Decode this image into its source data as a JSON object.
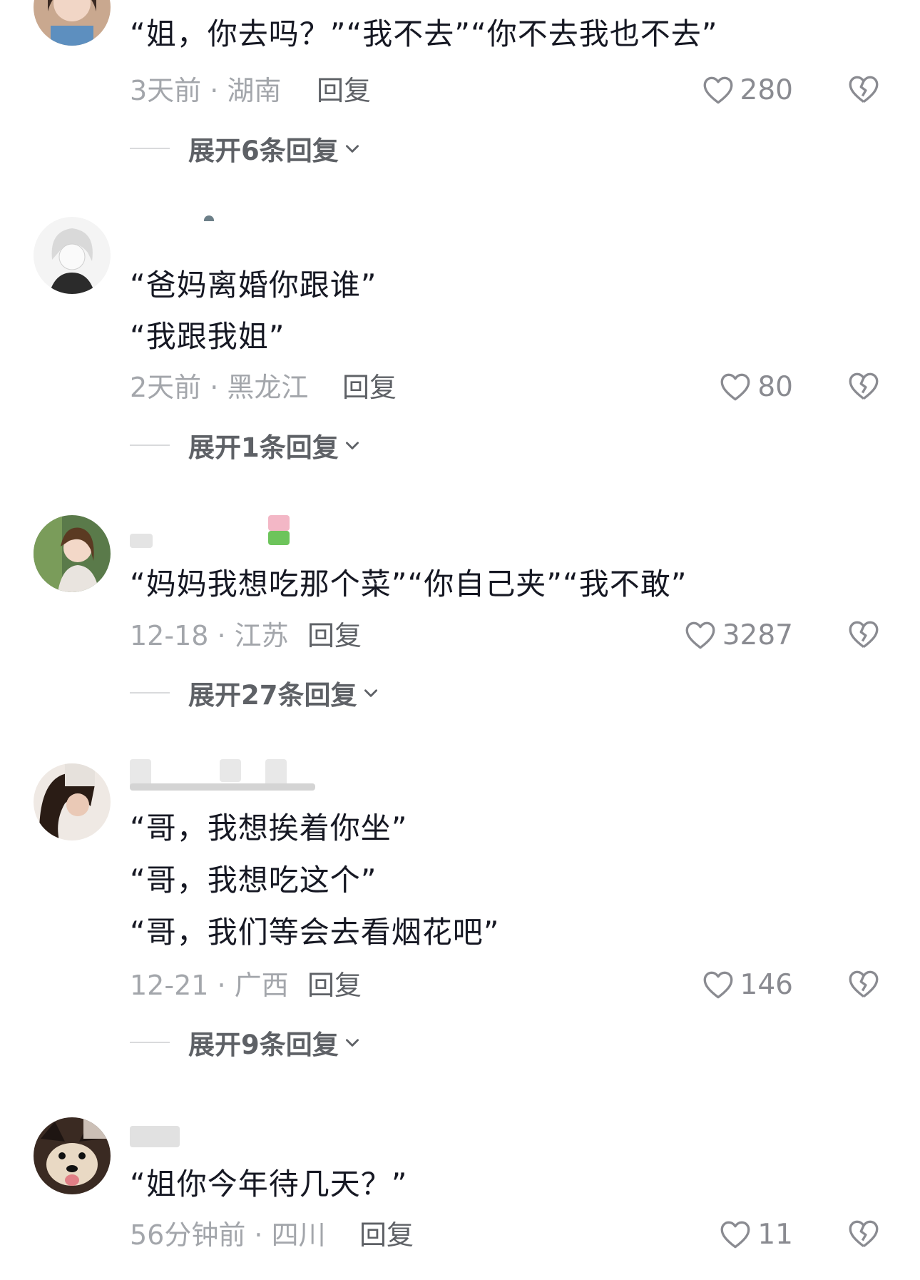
{
  "comments": [
    {
      "lines": [
        "“姐，你去吗？”“我不去”“你不去我也不去”"
      ],
      "time": "3天前",
      "location": "湖南",
      "meta": "3天前 · 湖南",
      "reply_label": "回复",
      "likes": "280",
      "expand": "展开6条回复"
    },
    {
      "lines": [
        "“爸妈离婚你跟谁”",
        "“我跟我姐”"
      ],
      "time": "2天前",
      "location": "黑龙江",
      "meta": "2天前 · 黑龙江",
      "reply_label": "回复",
      "likes": "80",
      "expand": "展开1条回复"
    },
    {
      "lines": [
        "“妈妈我想吃那个菜”“你自己夹”“我不敢”"
      ],
      "time": "12-18",
      "location": "江苏",
      "meta": "12-18 · 江苏",
      "reply_label": "回复",
      "likes": "3287",
      "expand": "展开27条回复"
    },
    {
      "lines": [
        "“哥，我想挨着你坐”",
        "“哥，我想吃这个”",
        "“哥，我们等会去看烟花吧”"
      ],
      "time": "12-21",
      "location": "广西",
      "meta": "12-21 · 广西",
      "reply_label": "回复",
      "likes": "146",
      "expand": "展开9条回复"
    },
    {
      "lines": [
        "“姐你今年待几天？”"
      ],
      "time": "56分钟前",
      "location": "四川",
      "meta": "56分钟前 · 四川",
      "reply_label": "回复",
      "likes": "11"
    }
  ],
  "icons": {
    "like": "heart-outline-icon",
    "dislike": "broken-heart-icon",
    "expand": "chevron-down-icon"
  },
  "colors": {
    "text": "#161823",
    "meta": "#a3a6ab",
    "action": "#5e6166",
    "icon": "#8a8b91"
  }
}
